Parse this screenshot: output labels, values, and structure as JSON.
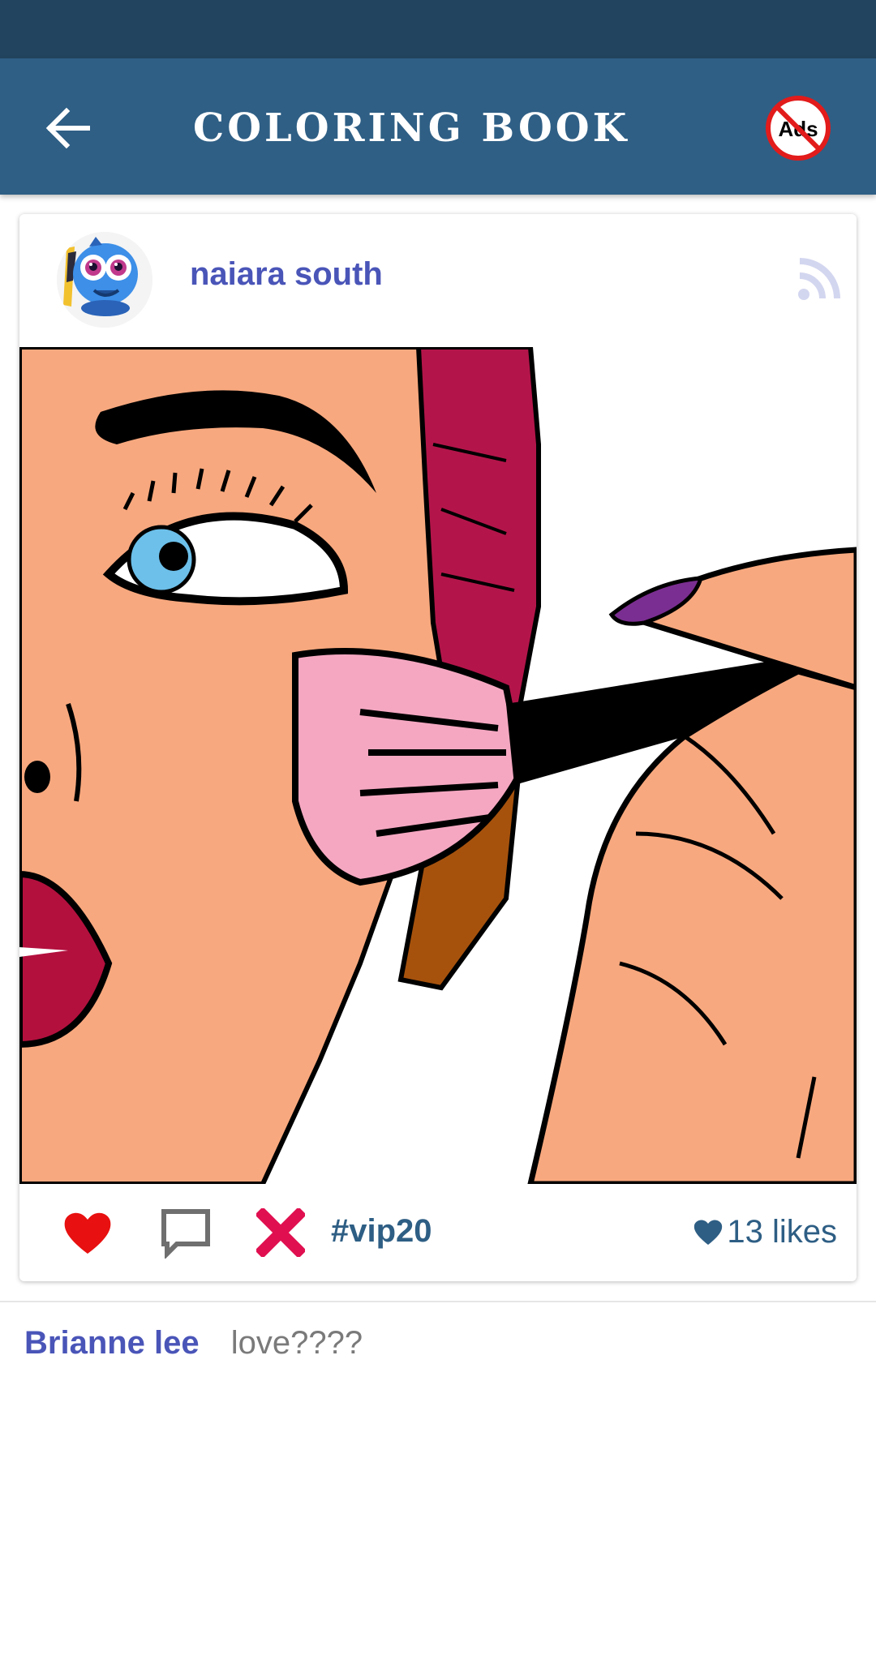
{
  "app_bar": {
    "title": "COLORING BOOK",
    "back_icon": "arrow-left-icon",
    "no_ads_label": "Ads",
    "background": "#2f5f85",
    "status_bar": "#23445e"
  },
  "post": {
    "username": "naiara south",
    "avatar_icon": "fish-character-avatar",
    "feed_icon": "rss-feed-icon",
    "hashtag": "#vip20",
    "likes_text": "13 likes",
    "liked": true,
    "accent": "#e81010",
    "username_color": "#4a55b8"
  },
  "comments": [
    {
      "author": "Brianne lee",
      "text": "love????"
    }
  ]
}
